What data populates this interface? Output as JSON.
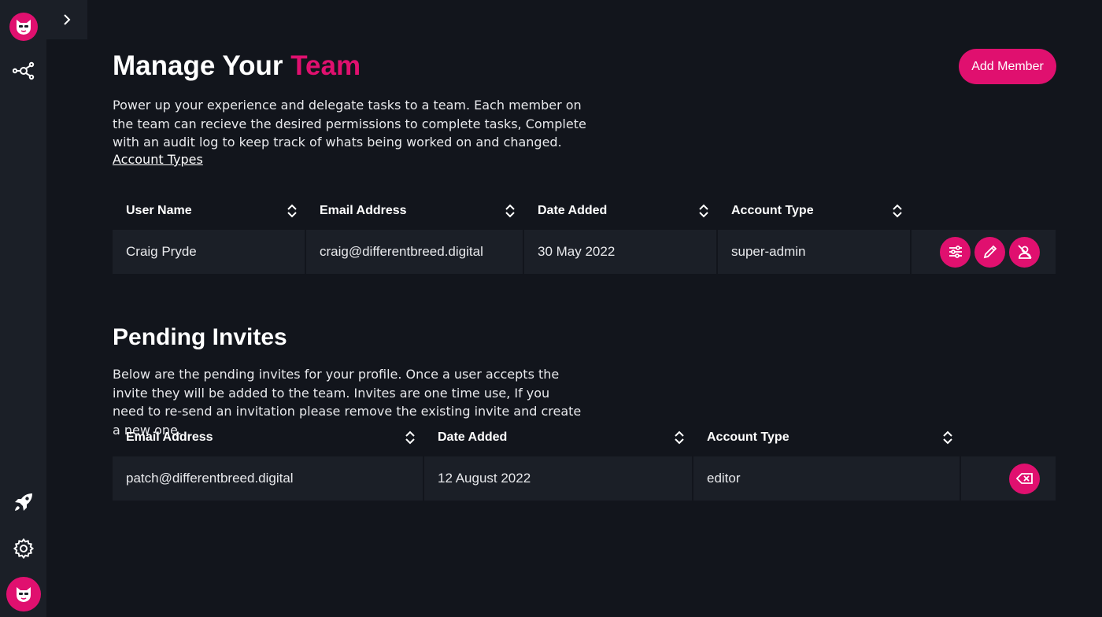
{
  "header": {
    "title_main": "Manage Your",
    "title_accent": "Team",
    "add_member_label": "Add Member"
  },
  "team": {
    "description": "Power up your experience and delegate tasks to a team. Each member on the team can recieve the desired permissions to complete tasks, Complete with an audit log to keep track of whats being worked on and changed.",
    "account_types_link": "Account Types",
    "columns": [
      "User Name",
      "Email Address",
      "Date Added",
      "Account Type"
    ],
    "rows": [
      {
        "user_name": "Craig Pryde",
        "email": "craig@differentbreed.digital",
        "date_added": "30 May 2022",
        "account_type": "super-admin",
        "actions": [
          "permissions-icon",
          "edit-icon",
          "remove-user-icon"
        ]
      }
    ]
  },
  "pending": {
    "title": "Pending Invites",
    "description": "Below are the pending invites for your profile. Once a user accepts the invite they will be added to the team. Invites are one time use, If you need to re-send an invitation please remove the existing invite and create a new one.",
    "columns": [
      "Email Address",
      "Date Added",
      "Account Type"
    ],
    "rows": [
      {
        "email": "patch@differentbreed.digital",
        "date_added": "12 August 2022",
        "account_type": "editor",
        "actions": [
          "delete-invite-icon"
        ]
      }
    ]
  },
  "sidebar": {
    "icons": [
      "logo-icon",
      "network-icon",
      "rocket-icon",
      "gear-icon",
      "avatar"
    ]
  },
  "colors": {
    "accent": "#e0106f",
    "background": "#12151c",
    "panel": "#1b1f27"
  }
}
